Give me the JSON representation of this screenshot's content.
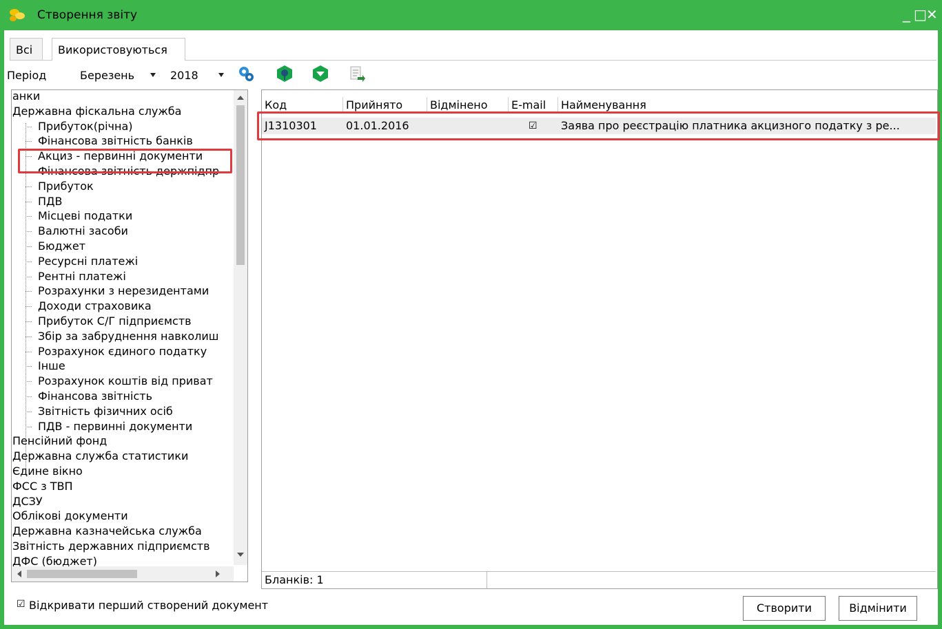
{
  "window": {
    "title": "Створення звіту",
    "minimize": "_",
    "maximize": "□",
    "close": "✕"
  },
  "tabs": [
    {
      "label": "Всі"
    },
    {
      "label": "Використовуються"
    }
  ],
  "toolbar": {
    "period_label": "Період",
    "month": "Березень",
    "year": "2018"
  },
  "tree": {
    "items": [
      {
        "label": "анки"
      },
      {
        "label": "Державна фіскальна служба"
      },
      {
        "label": "Прибуток(річна)"
      },
      {
        "label": "Фінансова звітність банків"
      },
      {
        "label": "Акциз - первинні документи"
      },
      {
        "label": "Фінансова звітність держпідпр"
      },
      {
        "label": "Прибуток"
      },
      {
        "label": "ПДВ"
      },
      {
        "label": "Місцеві податки"
      },
      {
        "label": "Валютні засоби"
      },
      {
        "label": "Бюджет"
      },
      {
        "label": "Ресурсні платежі"
      },
      {
        "label": "Рентні платежі"
      },
      {
        "label": "Розрахунки з нерезидентами"
      },
      {
        "label": "Доходи страховика"
      },
      {
        "label": "Прибуток С/Г підприємств"
      },
      {
        "label": "Збір за забруднення навколиш"
      },
      {
        "label": "Розрахунок єдиного податку"
      },
      {
        "label": "Інше"
      },
      {
        "label": "Розрахунок коштів від приват"
      },
      {
        "label": "Фінансова звітність"
      },
      {
        "label": "Звітність фізичних осіб"
      },
      {
        "label": "ПДВ - первинні документи"
      },
      {
        "label": "Пенсійний фонд"
      },
      {
        "label": "Державна служба статистики"
      },
      {
        "label": "Єдине вікно"
      },
      {
        "label": "ФСС з ТВП"
      },
      {
        "label": "ДСЗУ"
      },
      {
        "label": "Облікові документи"
      },
      {
        "label": "Державна казначейська служба"
      },
      {
        "label": "Звітність державних підприємств"
      },
      {
        "label": "ДФС (бюджет)"
      }
    ]
  },
  "grid": {
    "columns": [
      "Код",
      "Прийнято",
      "Відмінено",
      "E-mail",
      "Найменування"
    ],
    "rows": [
      {
        "code": "J1310301",
        "accepted": "01.01.2016",
        "cancelled": "",
        "email_checked": true,
        "name": "Заява про реєстрацію платника акцизного податку з ре..."
      }
    ],
    "status": "Бланків: 1"
  },
  "footer": {
    "checkbox_label": "Відкривати перший створений документ",
    "checkbox_checked": true,
    "create_label": "Створити",
    "cancel_label": "Відмінити"
  },
  "colors": {
    "frame": "#3cb54a",
    "highlight": "#e0393e"
  }
}
